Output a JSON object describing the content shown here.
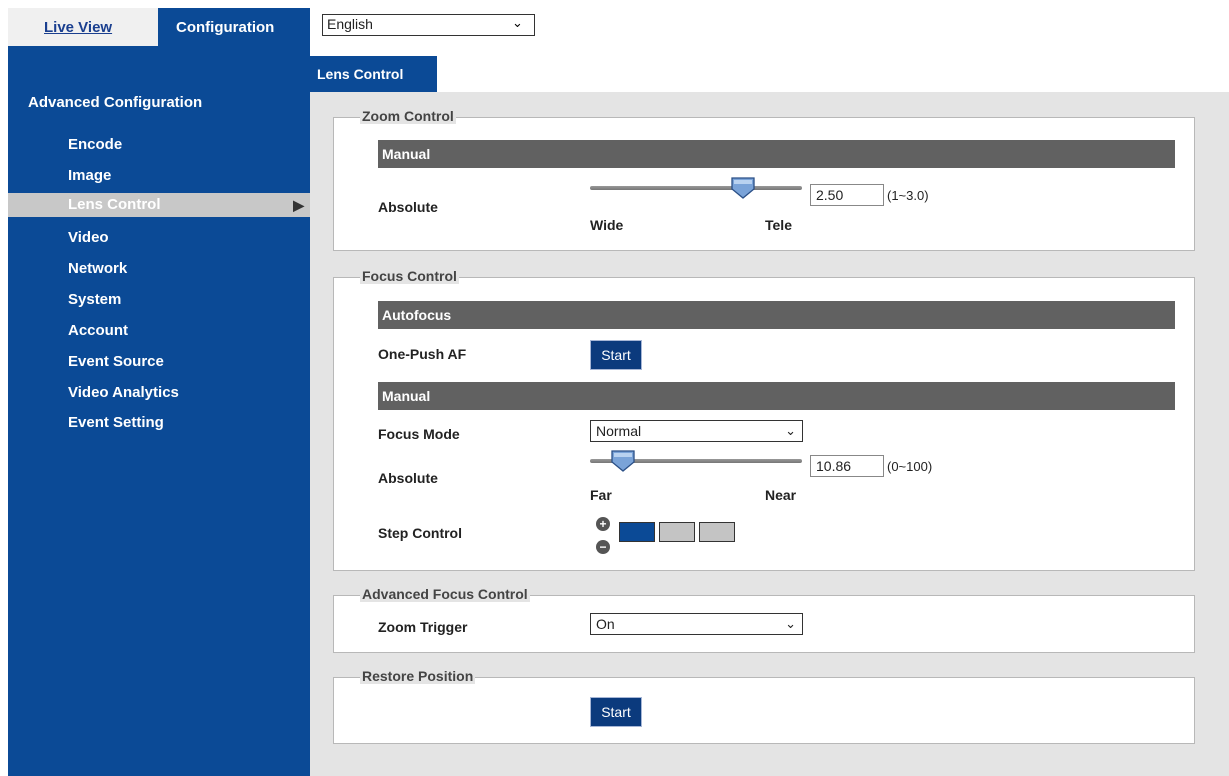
{
  "top_tabs": {
    "live_view": "Live View",
    "configuration": "Configuration"
  },
  "language": {
    "selected": "English"
  },
  "sidebar": {
    "title": "Advanced Configuration",
    "items": [
      {
        "label": "Encode"
      },
      {
        "label": "Image"
      },
      {
        "label": "Lens Control",
        "active": true
      },
      {
        "label": "Video"
      },
      {
        "label": "Network"
      },
      {
        "label": "System"
      },
      {
        "label": "Account"
      },
      {
        "label": "Event Source"
      },
      {
        "label": "Video Analytics"
      },
      {
        "label": "Event Setting"
      }
    ]
  },
  "page_tab": "Lens Control",
  "zoom_control": {
    "legend": "Zoom Control",
    "manual_header": "Manual",
    "absolute_label": "Absolute",
    "value": "2.50",
    "range": "(1~3.0)",
    "min_label": "Wide",
    "max_label": "Tele",
    "slider_fraction": 0.75
  },
  "focus_control": {
    "legend": "Focus Control",
    "autofocus_header": "Autofocus",
    "one_push_label": "One-Push AF",
    "start_label": "Start",
    "manual_header": "Manual",
    "focus_mode_label": "Focus Mode",
    "focus_mode_value": "Normal",
    "absolute_label": "Absolute",
    "value": "10.86",
    "range": "(0~100)",
    "min_label": "Far",
    "max_label": "Near",
    "slider_fraction": 0.1086,
    "step_label": "Step Control",
    "step_level": 1,
    "step_total": 3
  },
  "advanced_focus": {
    "legend": "Advanced Focus Control",
    "zoom_trigger_label": "Zoom Trigger",
    "zoom_trigger_value": "On"
  },
  "restore_position": {
    "legend": "Restore Position",
    "start_label": "Start"
  },
  "colors": {
    "brand_blue": "#0b4a96",
    "header_gray": "#616161",
    "step_active": "#0b4a96",
    "step_inactive": "#c4c4c4"
  }
}
